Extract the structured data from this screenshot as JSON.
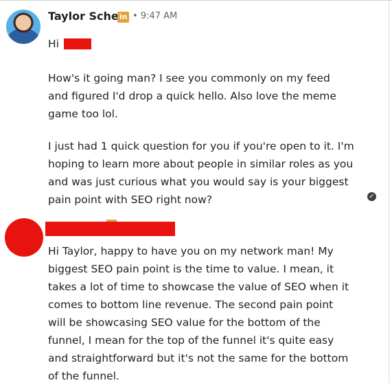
{
  "message1": {
    "sender_name": "Taylor Scher",
    "badge_text": "in",
    "meta": "• 9:47 AM",
    "hi": "Hi",
    "greeting": "How's it going man? I see you commonly on my feed and figured I'd drop a quick hello.  Also love the meme game too lol.",
    "question": "I just had 1 quick question for you if you're open to it. I'm hoping to learn more about people in similar roles as you and was just curious what you would say is your biggest pain point with SEO right now?",
    "status_icon": "check-circle-icon"
  },
  "message2": {
    "reply": "Hi Taylor, happy to have you on my network man! My biggest SEO pain point is the time to value. I mean, it takes a lot of time to showcase the value of SEO when it comes to bottom line revenue. The second pain point will be showcasing SEO value for the bottom of the funnel, I mean for the top of the funnel it's quite easy and straightforward but it's not the same for the bottom of the funnel."
  },
  "colors": {
    "redaction": "#e8120f",
    "badge": "#e3a13b",
    "text": "#1f1f1f",
    "meta": "#666666"
  }
}
